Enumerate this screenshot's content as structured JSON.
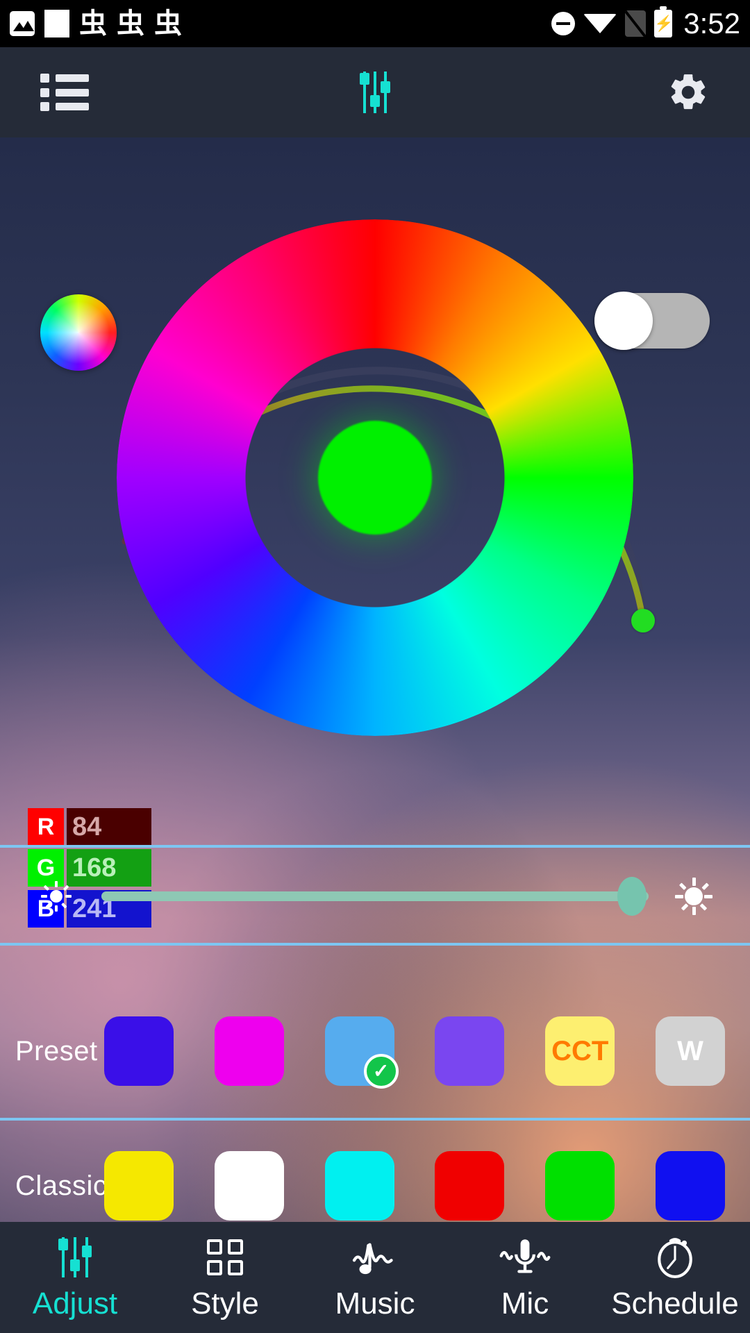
{
  "statusbar": {
    "time": "3:52",
    "left_icons": [
      "image-icon",
      "white-square-icon",
      "glyph-icon",
      "glyph-icon",
      "glyph-icon"
    ],
    "glyph": "虫",
    "right_icons": [
      "do-not-disturb-icon",
      "wifi-icon",
      "sim-off-icon",
      "battery-charging-icon"
    ]
  },
  "appbar": {
    "menu_icon": "list-icon",
    "title_icon": "sliders-icon",
    "settings_icon": "gear-icon"
  },
  "main": {
    "color_wheel_icon": "color-wheel-icon",
    "power_toggle": {
      "state": "off",
      "label": ""
    },
    "picker": {
      "selected_color": "#00f000",
      "handle_color": "#22dd22",
      "handle_angle_deg": 24
    },
    "rgb": {
      "rows": [
        {
          "key": "R",
          "value": "84",
          "key_bg": "#ff0000",
          "val_bg": "#4a0000",
          "val_fg": "#d6a8a8"
        },
        {
          "key": "G",
          "value": "168",
          "key_bg": "#00f000",
          "val_bg": "#13a013",
          "val_fg": "#b9f0b9"
        },
        {
          "key": "B",
          "value": "241",
          "key_bg": "#0000ff",
          "val_bg": "#1313ce",
          "val_fg": "#b8b8f5"
        }
      ]
    },
    "brightness": {
      "min_icon": "brightness-low-icon",
      "max_icon": "brightness-high-icon",
      "value_pct": 97,
      "track_color": "#8ec8b4",
      "thumb_color": "#76c4ae"
    },
    "preset": {
      "label": "Preset",
      "items": [
        {
          "name": "preset-blue-violet",
          "color": "#3a0fe8",
          "text": "",
          "text_color": "",
          "selected": false
        },
        {
          "name": "preset-magenta",
          "color": "#ee00ee",
          "text": "",
          "text_color": "",
          "selected": false
        },
        {
          "name": "preset-sky-blue",
          "color": "#56acee",
          "text": "",
          "text_color": "",
          "selected": true
        },
        {
          "name": "preset-purple",
          "color": "#7a46f0",
          "text": "",
          "text_color": "",
          "selected": false
        },
        {
          "name": "preset-cct",
          "color": "#fdef70",
          "text": "CCT",
          "text_color": "#ff7a00",
          "selected": false
        },
        {
          "name": "preset-white",
          "color": "#d2d2d2",
          "text": "W",
          "text_color": "#ffffff",
          "selected": false
        }
      ]
    },
    "classic": {
      "label": "Classic",
      "items": [
        {
          "name": "classic-yellow",
          "color": "#f5e800"
        },
        {
          "name": "classic-white",
          "color": "#ffffff"
        },
        {
          "name": "classic-cyan",
          "color": "#00f0f0"
        },
        {
          "name": "classic-red",
          "color": "#f00000"
        },
        {
          "name": "classic-green",
          "color": "#00e000"
        },
        {
          "name": "classic-blue",
          "color": "#1010f0"
        }
      ]
    }
  },
  "bottomnav": {
    "items": [
      {
        "label": "Adjust",
        "icon": "sliders-icon",
        "active": true
      },
      {
        "label": "Style",
        "icon": "grid-icon",
        "active": false
      },
      {
        "label": "Music",
        "icon": "music-note-wave-icon",
        "active": false
      },
      {
        "label": "Mic",
        "icon": "microphone-wave-icon",
        "active": false
      },
      {
        "label": "Schedule",
        "icon": "stopwatch-icon",
        "active": false
      }
    ],
    "active_color": "#16e0d2"
  }
}
